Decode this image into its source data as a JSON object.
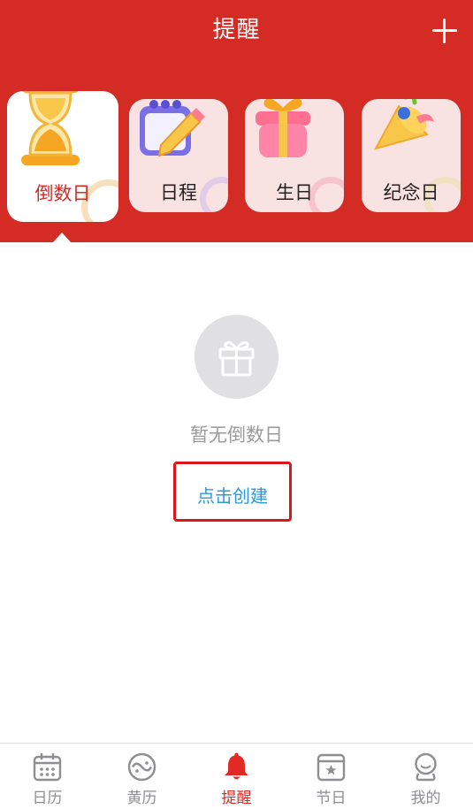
{
  "header": {
    "title": "提醒",
    "add_icon": "plus-icon"
  },
  "categories": [
    {
      "label": "倒数日",
      "icon": "hourglass-icon",
      "active": true
    },
    {
      "label": "日程",
      "icon": "calendar-pencil-icon",
      "active": false
    },
    {
      "label": "生日",
      "icon": "gift-box-icon",
      "active": false
    },
    {
      "label": "纪念日",
      "icon": "party-horn-icon",
      "active": false
    }
  ],
  "empty": {
    "icon": "gift-icon",
    "message": "暂无倒数日",
    "action": "点击创建"
  },
  "tabbar": [
    {
      "label": "日历",
      "icon": "calendar-icon",
      "active": false
    },
    {
      "label": "黄历",
      "icon": "yin-yang-icon",
      "active": false
    },
    {
      "label": "提醒",
      "icon": "bell-icon",
      "active": true
    },
    {
      "label": "节日",
      "icon": "festival-icon",
      "active": false
    },
    {
      "label": "我的",
      "icon": "profile-icon",
      "active": false
    }
  ],
  "colors": {
    "brand_red": "#d42b25",
    "link_blue": "#2a9ad6",
    "highlight_red": "#d8191c"
  }
}
